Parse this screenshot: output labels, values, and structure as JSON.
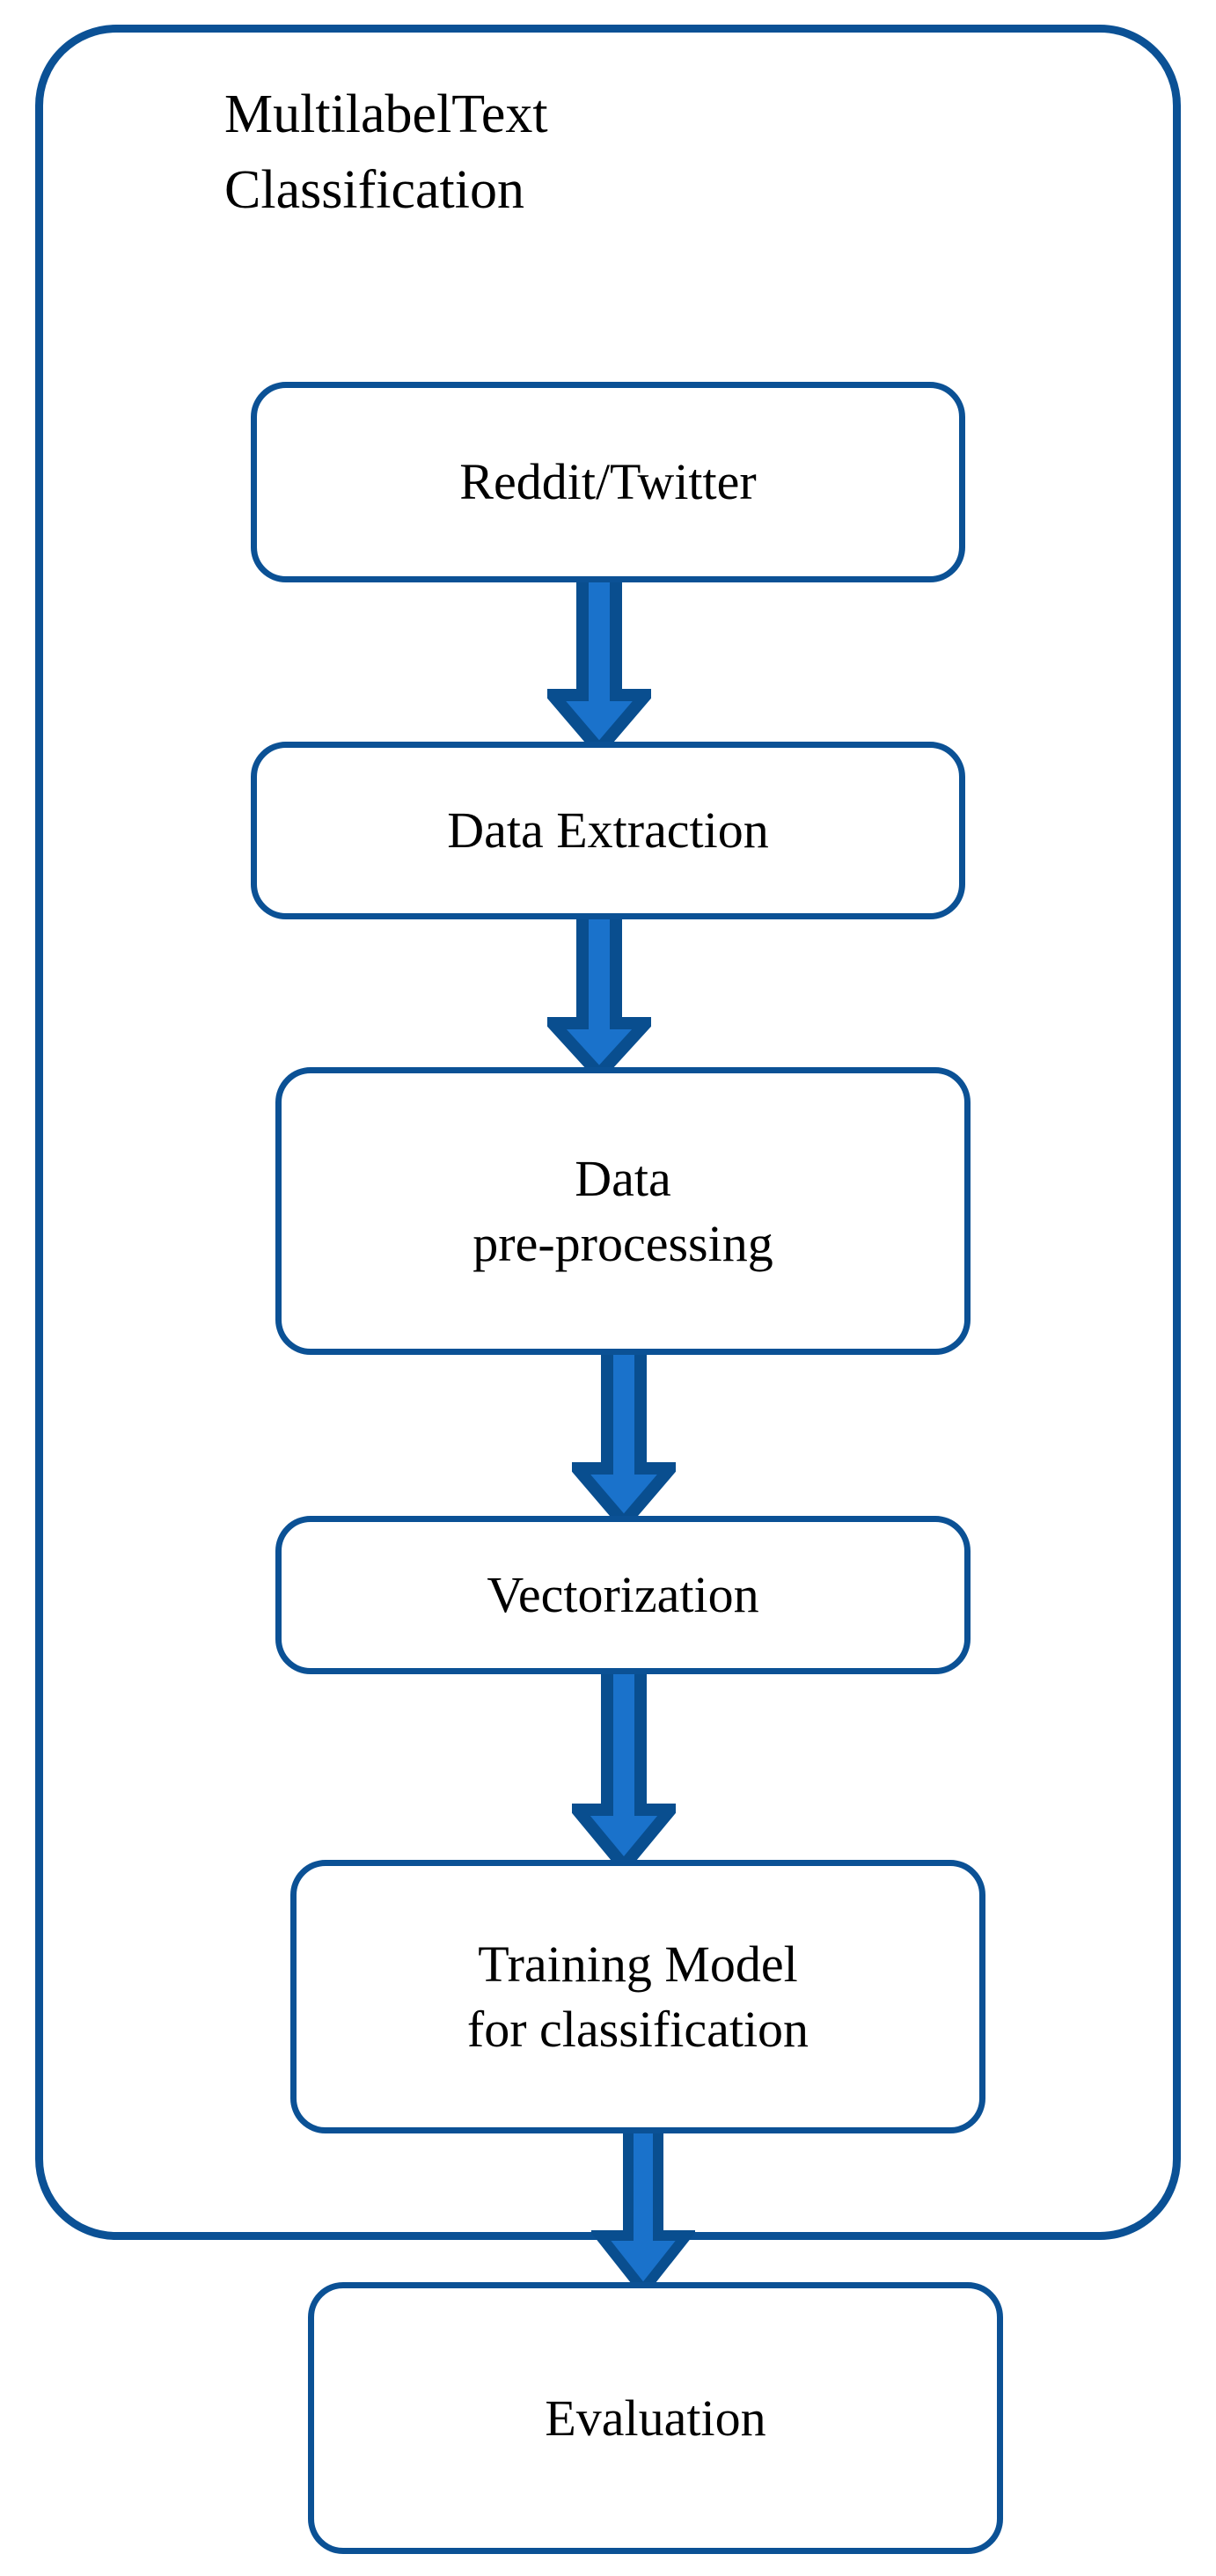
{
  "diagram": {
    "title": {
      "line1_left": "Multilabel",
      "line1_right": "Text",
      "line2": "Classification"
    },
    "colors": {
      "outline_blue": "#0B5195",
      "arrow_outline": "#094E8F",
      "arrow_fill": "#1A72CB",
      "text": "#000000",
      "background": "#FFFFFF"
    },
    "nodes": [
      {
        "id": "reddit-twitter",
        "label": "Reddit/Twitter"
      },
      {
        "id": "data-extraction",
        "label": "Data Extraction"
      },
      {
        "id": "data-preprocessing",
        "label": "Data\npre-processing"
      },
      {
        "id": "vectorization",
        "label": "Vectorization"
      },
      {
        "id": "training-model",
        "label": "Training Model\nfor classification"
      },
      {
        "id": "evaluation",
        "label": "Evaluation"
      }
    ],
    "arrows": [
      {
        "id": "arrow-reddit-to-extraction",
        "from": "reddit-twitter",
        "to": "data-extraction",
        "direction": "down"
      },
      {
        "id": "arrow-extraction-to-preprocess",
        "from": "data-extraction",
        "to": "data-preprocessing",
        "direction": "down"
      },
      {
        "id": "arrow-preprocess-to-vectorize",
        "from": "data-preprocessing",
        "to": "vectorization",
        "direction": "down"
      },
      {
        "id": "arrow-vectorize-to-training",
        "from": "vectorization",
        "to": "training-model",
        "direction": "down"
      },
      {
        "id": "arrow-training-to-evaluation",
        "from": "training-model",
        "to": "evaluation",
        "direction": "down"
      }
    ]
  },
  "chart_data": {
    "type": "diagram",
    "title": "Multilabel Text Classification",
    "flow": [
      "Reddit/Twitter",
      "Data Extraction",
      "Data pre-processing",
      "Vectorization",
      "Training Model for classification",
      "Evaluation"
    ],
    "grouping": {
      "container_label": "Multilabel Text Classification",
      "inside_container": [
        "Reddit/Twitter",
        "Data Extraction",
        "Data pre-processing",
        "Vectorization",
        "Training Model for classification"
      ],
      "outside_container": [
        "Evaluation"
      ]
    }
  }
}
